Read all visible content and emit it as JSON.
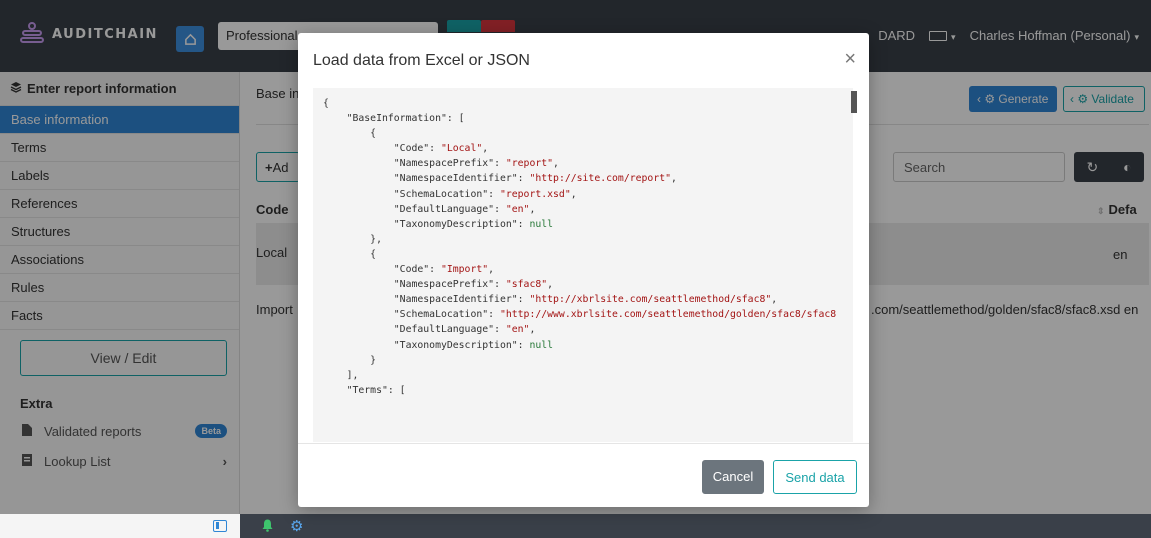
{
  "brand": {
    "name": "AUDITCHAIN"
  },
  "topbar": {
    "project": "Professional",
    "dashboard_fragment": "DARD",
    "language_caret": "▾",
    "user": "Charles Hoffman (Personal)"
  },
  "sidebar": {
    "header": "Enter report information",
    "items": [
      {
        "label": "Base information"
      },
      {
        "label": "Terms"
      },
      {
        "label": "Labels"
      },
      {
        "label": "References"
      },
      {
        "label": "Structures"
      },
      {
        "label": "Associations"
      },
      {
        "label": "Rules"
      },
      {
        "label": "Facts"
      }
    ],
    "view_edit": "View / Edit",
    "extra": "Extra",
    "validated_reports": "Validated reports",
    "beta": "Beta",
    "lookup_list": "Lookup List"
  },
  "main": {
    "breadcrumb": "Base in",
    "generate": "Generate",
    "validate": "Validate",
    "add": "Ad",
    "search_placeholder": "Search",
    "columns": {
      "code": "Code",
      "default": "Defa"
    },
    "rows": [
      {
        "code": "Local",
        "lang": "en"
      },
      {
        "code": "Import",
        "url": ".com/seattlemethod/golden/sfac8/sfac8.xsd en"
      }
    ]
  },
  "modal": {
    "title": "Load data from Excel or JSON",
    "close": "×",
    "cancel": "Cancel",
    "send": "Send data",
    "json": {
      "base_information_key": "\"BaseInformation\"",
      "terms_key": "\"Terms\"",
      "entries": [
        {
          "code": "\"Local\"",
          "namespace_prefix": "\"report\"",
          "namespace_identifier": "\"http://site.com/report\"",
          "schema_location": "\"report.xsd\"",
          "default_language": "\"en\"",
          "taxonomy_description": "null"
        },
        {
          "code": "\"Import\"",
          "namespace_prefix": "\"sfac8\"",
          "namespace_identifier": "\"http://xbrlsite.com/seattlemethod/sfac8\"",
          "schema_location": "\"http://www.xbrlsite.com/seattlemethod/golden/sfac8/sfac8",
          "default_language": "\"en\"",
          "taxonomy_description": "null"
        }
      ]
    }
  },
  "colors": {
    "topbar": "#3a4049",
    "accent_blue": "#2f86d5",
    "accent_teal": "#1aa3a8"
  }
}
